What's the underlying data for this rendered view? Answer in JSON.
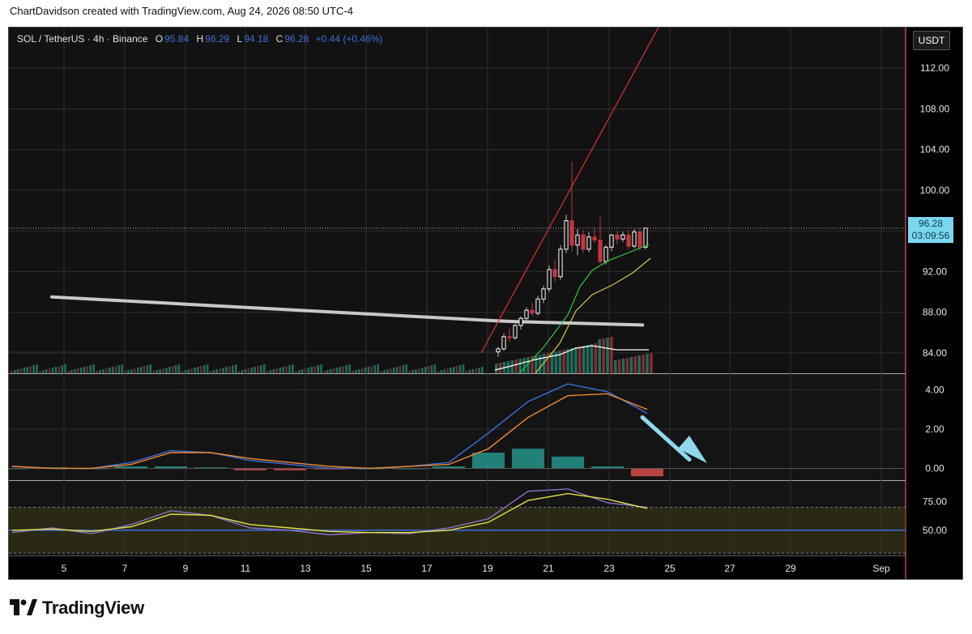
{
  "header": {
    "credit": "ChartDavidson created with TradingView.com, Aug 24, 2026 08:50 UTC-4"
  },
  "legend": {
    "symbol": "SOL / TetherUS · 4h · Binance",
    "o_label": "O",
    "o_value": "95.84",
    "h_label": "H",
    "h_value": "96.29",
    "l_label": "L",
    "l_value": "94.18",
    "c_label": "C",
    "c_value": "96.28",
    "change": "+0.44 (+0.46%)"
  },
  "currency_button": "USDT",
  "price_tag": {
    "price": "96.28",
    "countdown": "03:09:56"
  },
  "brand": {
    "name": "TradingView"
  },
  "colors": {
    "up": "#ffffff",
    "down": "#c8343f",
    "ema_fast": "#2ecc40",
    "ema_slow": "#d4c84a",
    "ma_long": "#c8c8c8",
    "macd": "#3b6fe0",
    "signal": "#f08a2c",
    "rsi": "#8a73c9",
    "rsi_ma": "#e8e044",
    "arrow": "#8fd8ee",
    "trendline": "#e03030"
  },
  "chart_data": [
    {
      "type": "candlestick",
      "title": "SOL / TetherUS · 4h · Binance",
      "ylim": [
        82,
        116
      ],
      "y_ticks": [
        "112.00",
        "108.00",
        "104.00",
        "100.00",
        "96.00",
        "92.00",
        "88.00",
        "84.00"
      ],
      "x_ticks": [
        "5",
        "7",
        "9",
        "11",
        "13",
        "15",
        "17",
        "19",
        "21",
        "23",
        "25",
        "27",
        "29",
        "Sep"
      ],
      "last_price": 96.28,
      "candles": [
        {
          "o": 84.1,
          "h": 84.6,
          "l": 83.6,
          "c": 84.4
        },
        {
          "o": 84.4,
          "h": 85.9,
          "l": 84.2,
          "c": 85.6
        },
        {
          "o": 85.6,
          "h": 86.4,
          "l": 85.1,
          "c": 85.5
        },
        {
          "o": 85.5,
          "h": 86.9,
          "l": 85.3,
          "c": 86.7
        },
        {
          "o": 86.7,
          "h": 87.6,
          "l": 86.3,
          "c": 87.4
        },
        {
          "o": 87.4,
          "h": 88.5,
          "l": 87.0,
          "c": 88.2
        },
        {
          "o": 88.2,
          "h": 88.9,
          "l": 87.6,
          "c": 87.9
        },
        {
          "o": 87.9,
          "h": 89.6,
          "l": 87.7,
          "c": 89.3
        },
        {
          "o": 89.3,
          "h": 90.6,
          "l": 88.9,
          "c": 90.3
        },
        {
          "o": 90.3,
          "h": 92.6,
          "l": 90.0,
          "c": 92.2
        },
        {
          "o": 92.2,
          "h": 93.2,
          "l": 91.0,
          "c": 91.5
        },
        {
          "o": 91.5,
          "h": 94.6,
          "l": 91.2,
          "c": 94.2
        },
        {
          "o": 94.2,
          "h": 97.6,
          "l": 93.8,
          "c": 97.0
        },
        {
          "o": 97.0,
          "h": 102.8,
          "l": 94.0,
          "c": 94.6
        },
        {
          "o": 94.6,
          "h": 96.2,
          "l": 93.6,
          "c": 95.6
        },
        {
          "o": 95.6,
          "h": 96.1,
          "l": 93.8,
          "c": 94.2
        },
        {
          "o": 94.2,
          "h": 95.9,
          "l": 93.9,
          "c": 95.4
        },
        {
          "o": 95.4,
          "h": 96.3,
          "l": 94.8,
          "c": 95.1
        },
        {
          "o": 95.1,
          "h": 97.4,
          "l": 92.8,
          "c": 93.0
        },
        {
          "o": 93.0,
          "h": 94.6,
          "l": 92.7,
          "c": 94.4
        },
        {
          "o": 94.4,
          "h": 95.7,
          "l": 94.0,
          "c": 95.6
        },
        {
          "o": 95.6,
          "h": 96.0,
          "l": 94.7,
          "c": 95.2
        },
        {
          "o": 95.2,
          "h": 95.9,
          "l": 94.9,
          "c": 95.6
        },
        {
          "o": 95.6,
          "h": 96.1,
          "l": 94.2,
          "c": 94.5
        },
        {
          "o": 94.5,
          "h": 96.2,
          "l": 94.3,
          "c": 95.9
        },
        {
          "o": 95.9,
          "h": 96.3,
          "l": 94.1,
          "c": 94.4
        },
        {
          "o": 94.4,
          "h": 96.29,
          "l": 94.18,
          "c": 96.28
        }
      ]
    },
    {
      "type": "line",
      "title": "MACD",
      "ylim": [
        -0.6,
        4.8
      ],
      "y_ticks": [
        "4.00",
        "2.00",
        "0.00"
      ],
      "series": [
        {
          "values": [
            0.1,
            0.0,
            0.0,
            0.3,
            0.9,
            0.8,
            0.4,
            0.2,
            0.0,
            0.0,
            0.1,
            0.3,
            1.8,
            3.4,
            4.3,
            3.9,
            2.8
          ]
        },
        {
          "values": [
            0.1,
            0.0,
            0.0,
            0.2,
            0.8,
            0.8,
            0.5,
            0.3,
            0.1,
            0.0,
            0.1,
            0.2,
            1.0,
            2.6,
            3.7,
            3.8,
            3.0
          ]
        }
      ],
      "histogram": [
        0.0,
        0.05,
        0.0,
        0.1,
        0.1,
        0.05,
        -0.1,
        -0.1,
        -0.05,
        0.0,
        0.0,
        0.1,
        0.8,
        1.0,
        0.6,
        0.1,
        -0.4
      ]
    },
    {
      "type": "line",
      "title": "RSI",
      "ylim": [
        28,
        93
      ],
      "y_ticks": [
        "75.00",
        "50.00"
      ],
      "series": [
        {
          "values": [
            48,
            52,
            47,
            55,
            67,
            63,
            52,
            50,
            46,
            48,
            47,
            52,
            60,
            84,
            86,
            74,
            70
          ]
        },
        {
          "values": [
            50,
            51,
            49,
            53,
            64,
            63,
            55,
            52,
            49,
            48,
            48,
            50,
            57,
            76,
            82,
            77,
            69
          ]
        }
      ]
    }
  ]
}
